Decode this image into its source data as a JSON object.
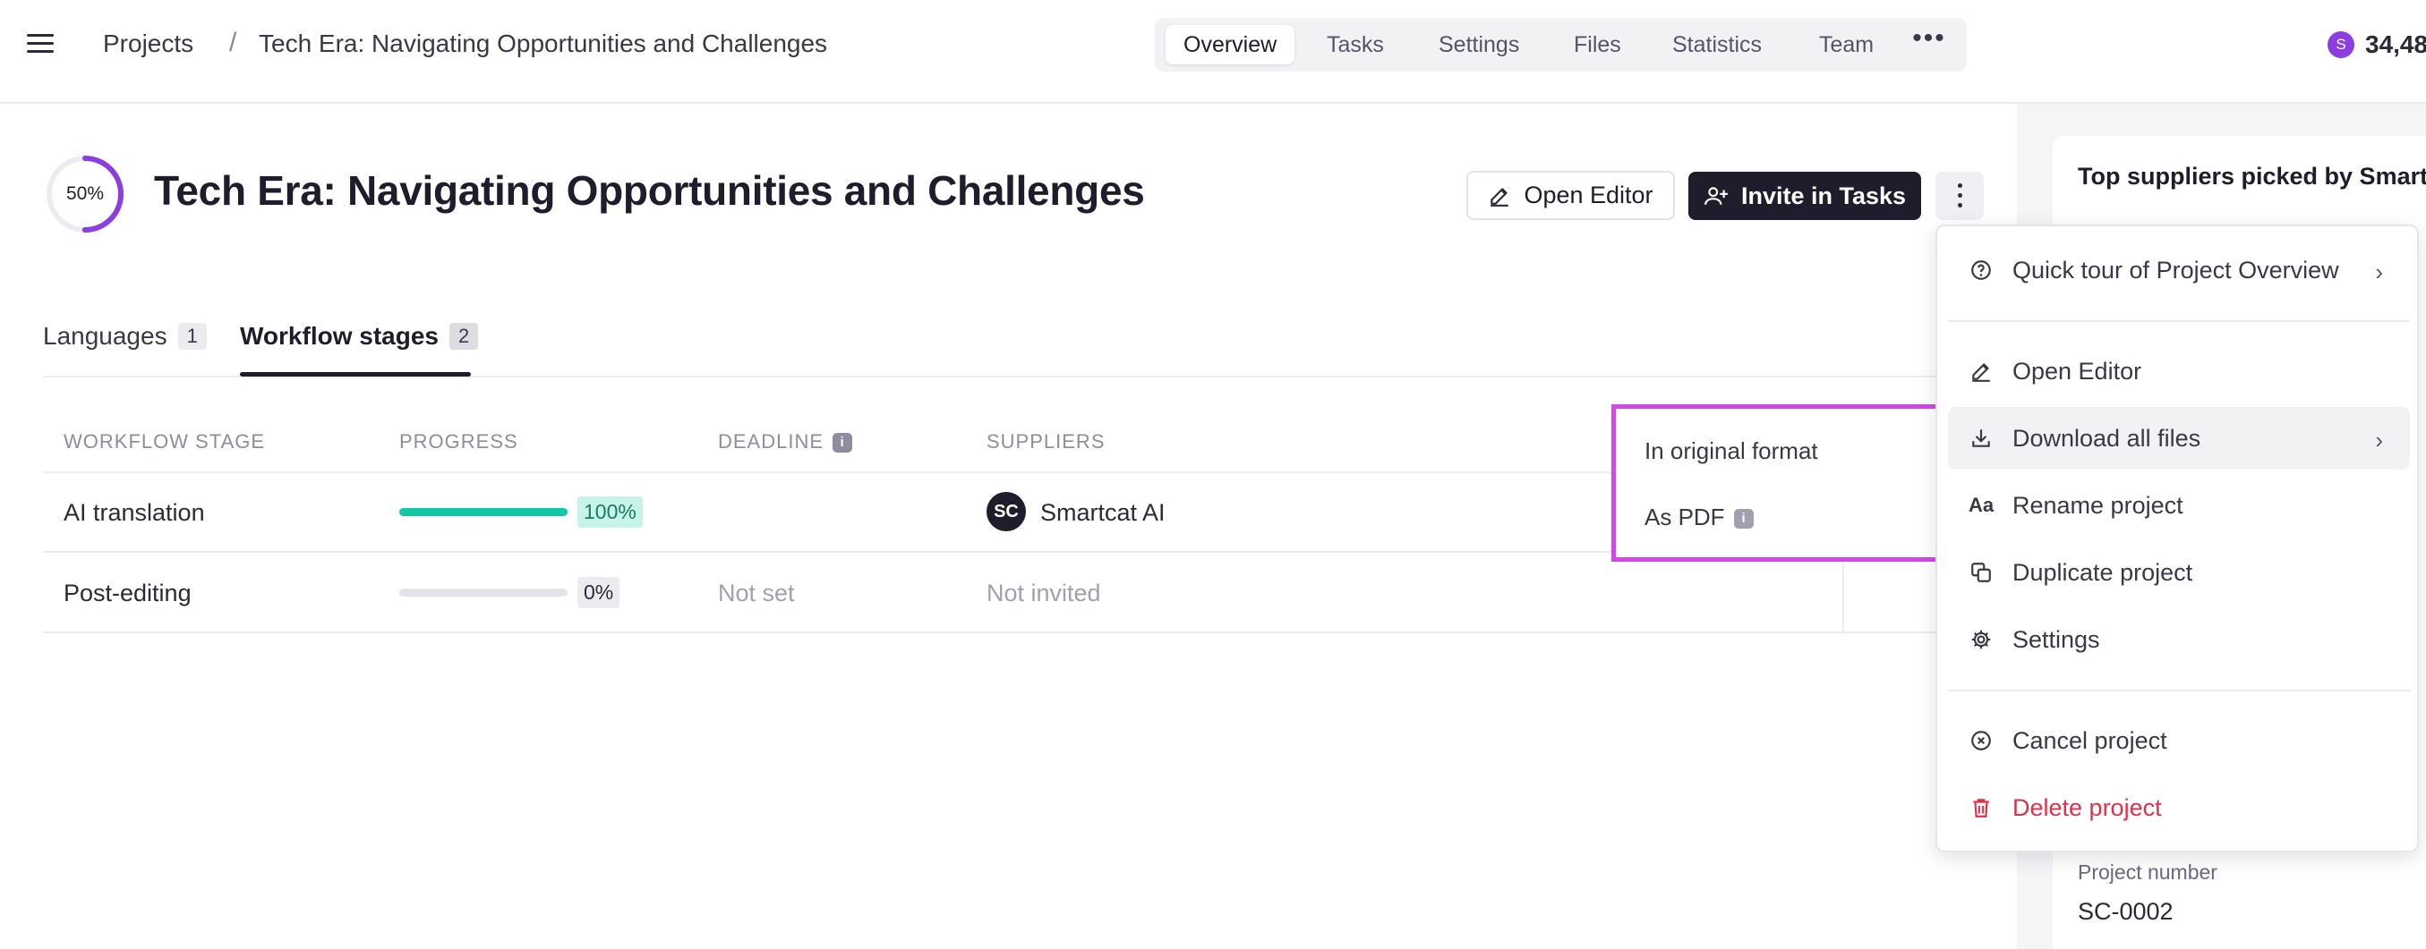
{
  "header": {
    "breadcrumb_root": "Projects",
    "breadcrumb_sep": "/",
    "breadcrumb_current": "Tech Era: Navigating Opportunities and Challenges",
    "tabs": [
      "Overview",
      "Tasks",
      "Settings",
      "Files",
      "Statistics",
      "Team"
    ],
    "active_tab": "Overview",
    "more": "•••",
    "balance_initial": "S",
    "balance_amount": "34,48"
  },
  "project": {
    "progress_label": "50%",
    "progress_fraction": 0.5,
    "title": "Tech Era: Navigating Opportunities and Challenges",
    "open_editor_label": "Open Editor",
    "invite_label": "Invite in Tasks"
  },
  "subtabs": [
    {
      "label": "Languages",
      "count": "1"
    },
    {
      "label": "Workflow stages",
      "count": "2"
    }
  ],
  "table": {
    "headers": [
      "WORKFLOW STAGE",
      "PROGRESS",
      "DEADLINE",
      "SUPPLIERS"
    ],
    "deadline_info": "i",
    "rows": [
      {
        "stage": "AI translation",
        "progress_label": "100%",
        "progress": 1.0,
        "deadline": "",
        "supplier": "Smartcat AI",
        "supplier_logo": "SC"
      },
      {
        "stage": "Post-editing",
        "progress_label": "0%",
        "progress": 0.0,
        "deadline": "Not set",
        "supplier": "Not invited"
      }
    ]
  },
  "submenu": {
    "items": [
      "In original format",
      "As PDF"
    ],
    "info": "i",
    "highlight_color": "#d347e6"
  },
  "right_panel": {
    "heading": "Top suppliers picked by Smartc",
    "project_number_label": "Project number",
    "project_number": "SC-0002"
  },
  "menu": {
    "items": [
      {
        "label": "Quick tour of Project Overview",
        "icon": "question-circle-icon",
        "chevron": "›"
      },
      {
        "label": "Open Editor",
        "icon": "pencil-icon"
      },
      {
        "label": "Download all files",
        "icon": "download-icon",
        "chevron": "›"
      },
      {
        "label": "Rename project",
        "icon": "rename-aa-icon",
        "icon_text": "Aa"
      },
      {
        "label": "Duplicate project",
        "icon": "duplicate-icon"
      },
      {
        "label": "Settings",
        "icon": "gear-icon"
      },
      {
        "label": "Cancel project",
        "icon": "cancel-circle-icon"
      },
      {
        "label": "Delete project",
        "icon": "trash-icon"
      }
    ]
  },
  "colors": {
    "accent_purple": "#8c3ee0",
    "progress_green": "#12c8a4",
    "danger_red": "#e0304b",
    "dark": "#1f1d2b"
  }
}
